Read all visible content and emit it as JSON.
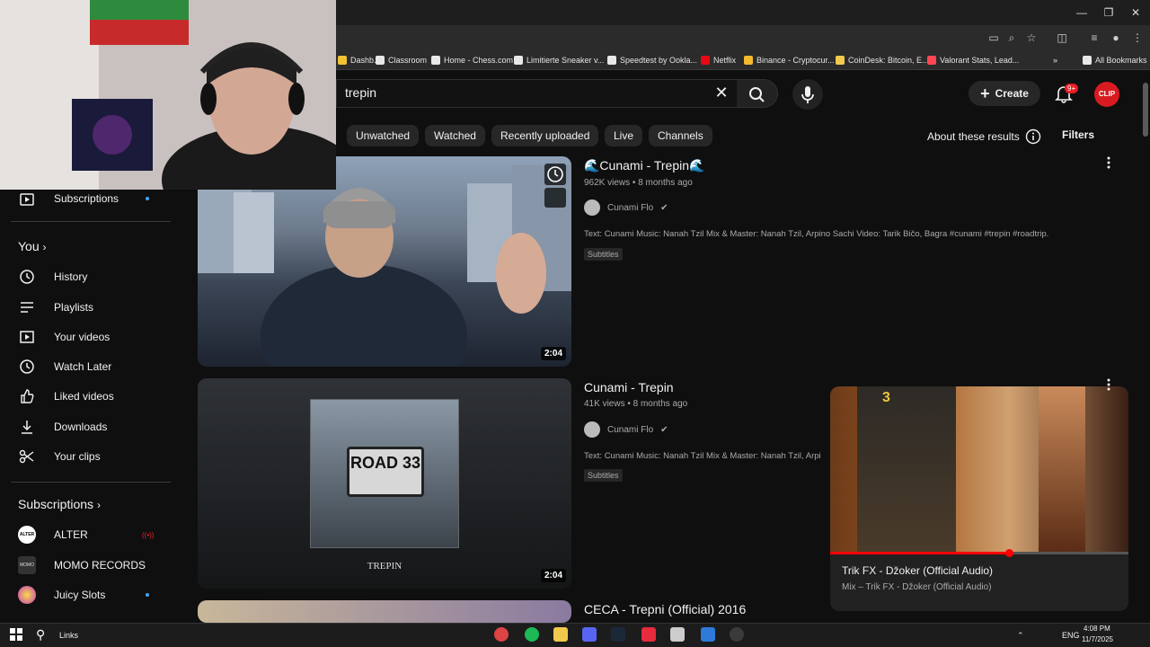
{
  "bookmarks": [
    {
      "label": "Dashb...",
      "color": "#f1c232"
    },
    {
      "label": "Classroom",
      "color": "#e8e8e8"
    },
    {
      "label": "Home - Chess.com",
      "color": "#e8e8e8"
    },
    {
      "label": "Limitierte Sneaker v...",
      "color": "#e8e8e8"
    },
    {
      "label": "Speedtest by Ookla...",
      "color": "#e8e8e8"
    },
    {
      "label": "Netflix",
      "color": "#e50914"
    },
    {
      "label": "Binance - Cryptocur...",
      "color": "#f3ba2f"
    },
    {
      "label": "CoinDesk: Bitcoin, E...",
      "color": "#f2c94c"
    },
    {
      "label": "Valorant Stats, Lead...",
      "color": "#ff4655"
    },
    {
      "label": "All Bookmarks",
      "color": "#e8e8e8"
    }
  ],
  "search": {
    "query": "trepin"
  },
  "header": {
    "create_label": "Create",
    "notification_count": "9+",
    "avatar_text": "CLIP"
  },
  "chips": [
    "Unwatched",
    "Watched",
    "Recently uploaded",
    "Live",
    "Channels"
  ],
  "about_results": "About these results",
  "filters_label": "Filters",
  "sidebar": {
    "top_items": [
      {
        "label": "Subscriptions",
        "icon": "subscriptions-icon"
      }
    ],
    "you_heading": "You",
    "you_items": [
      {
        "label": "History",
        "icon": "history-icon"
      },
      {
        "label": "Playlists",
        "icon": "playlists-icon"
      },
      {
        "label": "Your videos",
        "icon": "your-videos-icon"
      },
      {
        "label": "Watch Later",
        "icon": "clock-icon"
      },
      {
        "label": "Liked videos",
        "icon": "thumbs-up-icon"
      },
      {
        "label": "Downloads",
        "icon": "download-icon"
      },
      {
        "label": "Your clips",
        "icon": "scissors-icon"
      }
    ],
    "subs_heading": "Subscriptions",
    "subscriptions": [
      {
        "name": "ALTER",
        "status": "live"
      },
      {
        "name": "MOMO RECORDS",
        "status": ""
      },
      {
        "name": "Juicy Slots",
        "status": "new"
      }
    ]
  },
  "results": [
    {
      "title": "🌊Cunami - Trepin🌊",
      "views": "962K views",
      "age": "8 months ago",
      "channel": "Cunami Flo",
      "description": "Text: Cunami Music: Nanah Tzil Mix & Master: Nanah Tzil, Arpino Sachi Video: Tarik Bičo, Bagra #cunami #trepin #roadtrip.",
      "badge": "Subtitles",
      "duration": "2:04"
    },
    {
      "title": "Cunami - Trepin",
      "views": "41K views",
      "age": "8 months ago",
      "channel": "Cunami Flo",
      "description": "Text: Cunami Music: Nanah Tzil Mix & Master: Nanah Tzil, Arpi",
      "badge": "Subtitles",
      "duration": "2:04",
      "cover_title": "ROAD 33",
      "cover_caption": "TREPIN"
    },
    {
      "title": "CECA - Trepni (Official) 2016"
    }
  ],
  "miniplayer": {
    "title": "Trik FX - Džoker (Official Audio)",
    "subtitle": "Mix – Trik FX - Džoker (Official Audio)",
    "cover_number": "3",
    "progress": 0.6
  },
  "taskbar": {
    "search_label": "Links",
    "language": "ENG",
    "time": "4:08 PM",
    "date": "11/7/2025"
  }
}
